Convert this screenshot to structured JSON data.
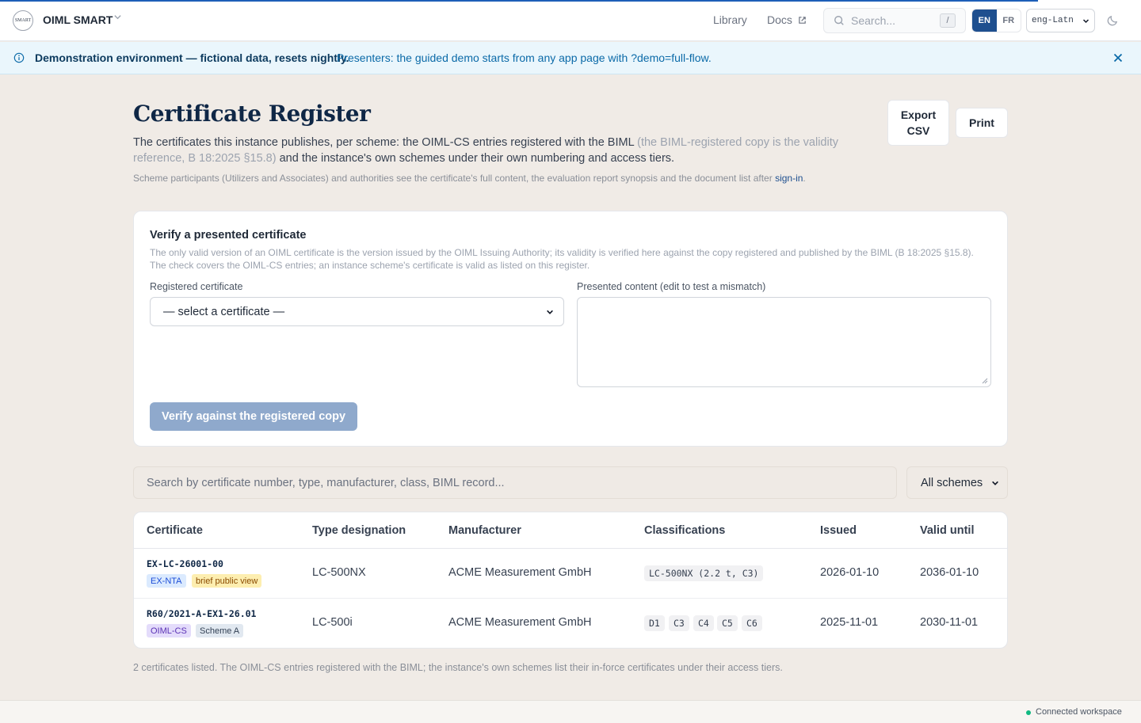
{
  "app": {
    "logo_text": "SMART",
    "title": "OIML SMART",
    "nav": {
      "library": "Library",
      "docs": "Docs"
    },
    "search": {
      "placeholder": "Search...",
      "shortcut": "/"
    },
    "languages": [
      "EN",
      "FR"
    ],
    "active_language": "EN",
    "script": "eng-Latn"
  },
  "banner": {
    "headline": "Demonstration environment — fictional data, resets nightly.",
    "detail": "Presenters: the guided demo starts from any app page with ?demo=full-flow."
  },
  "page": {
    "title": "Certificate Register",
    "desc_main": "The certificates this instance publishes, per scheme: the OIML-CS entries registered with the BIML",
    "desc_muted": "(the BIML-registered copy is the validity reference, B 18:2025 §15.8)",
    "desc_end": "and the instance's own schemes under their own numbering and access tiers.",
    "note_text": "Scheme participants (Utilizers and Associates) and authorities see the certificate's full content, the evaluation report synopsis and the document list after",
    "note_link": "sign-in",
    "note_end": ".",
    "export_label": "Export CSV",
    "print_label": "Print"
  },
  "verify": {
    "title": "Verify a presented certificate",
    "description": "The only valid version of an OIML certificate is the version issued by the OIML Issuing Authority; its validity is verified here against the copy registered and published by the BIML (B 18:2025 §15.8). The check covers the OIML-CS entries; an instance scheme's certificate is valid as listed on this register.",
    "registered_label": "Registered certificate",
    "select_value": "— select a certificate —",
    "presented_label": "Presented content (edit to test a mismatch)",
    "presented_value": "",
    "button": "Verify against the registered copy"
  },
  "filter": {
    "placeholder": "Search by certificate number, type, manufacturer, class, BIML record...",
    "scheme": "All schemes"
  },
  "table": {
    "columns": [
      "Certificate",
      "Type designation",
      "Manufacturer",
      "Classifications",
      "Issued",
      "Valid until"
    ],
    "rows": [
      {
        "certificate": "EX-LC-26001-00",
        "tags": [
          "EX-NTA",
          "brief public view"
        ],
        "type": "LC-500NX",
        "manufacturer": "ACME Measurement GmbH",
        "classifications": [
          "LC-500NX (2.2 t, C3)"
        ],
        "issued": "2026-01-10",
        "valid_until": "2036-01-10"
      },
      {
        "certificate": "R60/2021-A-EX1-26.01",
        "tags": [
          "OIML-CS",
          "Scheme A"
        ],
        "type": "LC-500i",
        "manufacturer": "ACME Measurement GmbH",
        "classifications": [
          "D1",
          "C3",
          "C4",
          "C5",
          "C6"
        ],
        "issued": "2025-11-01",
        "valid_until": "2030-11-01"
      }
    ],
    "footer": "2 certificates listed. The OIML-CS entries registered with the BIML; the instance's own schemes list their in-force certificates under their access tiers."
  },
  "status": "Connected workspace"
}
